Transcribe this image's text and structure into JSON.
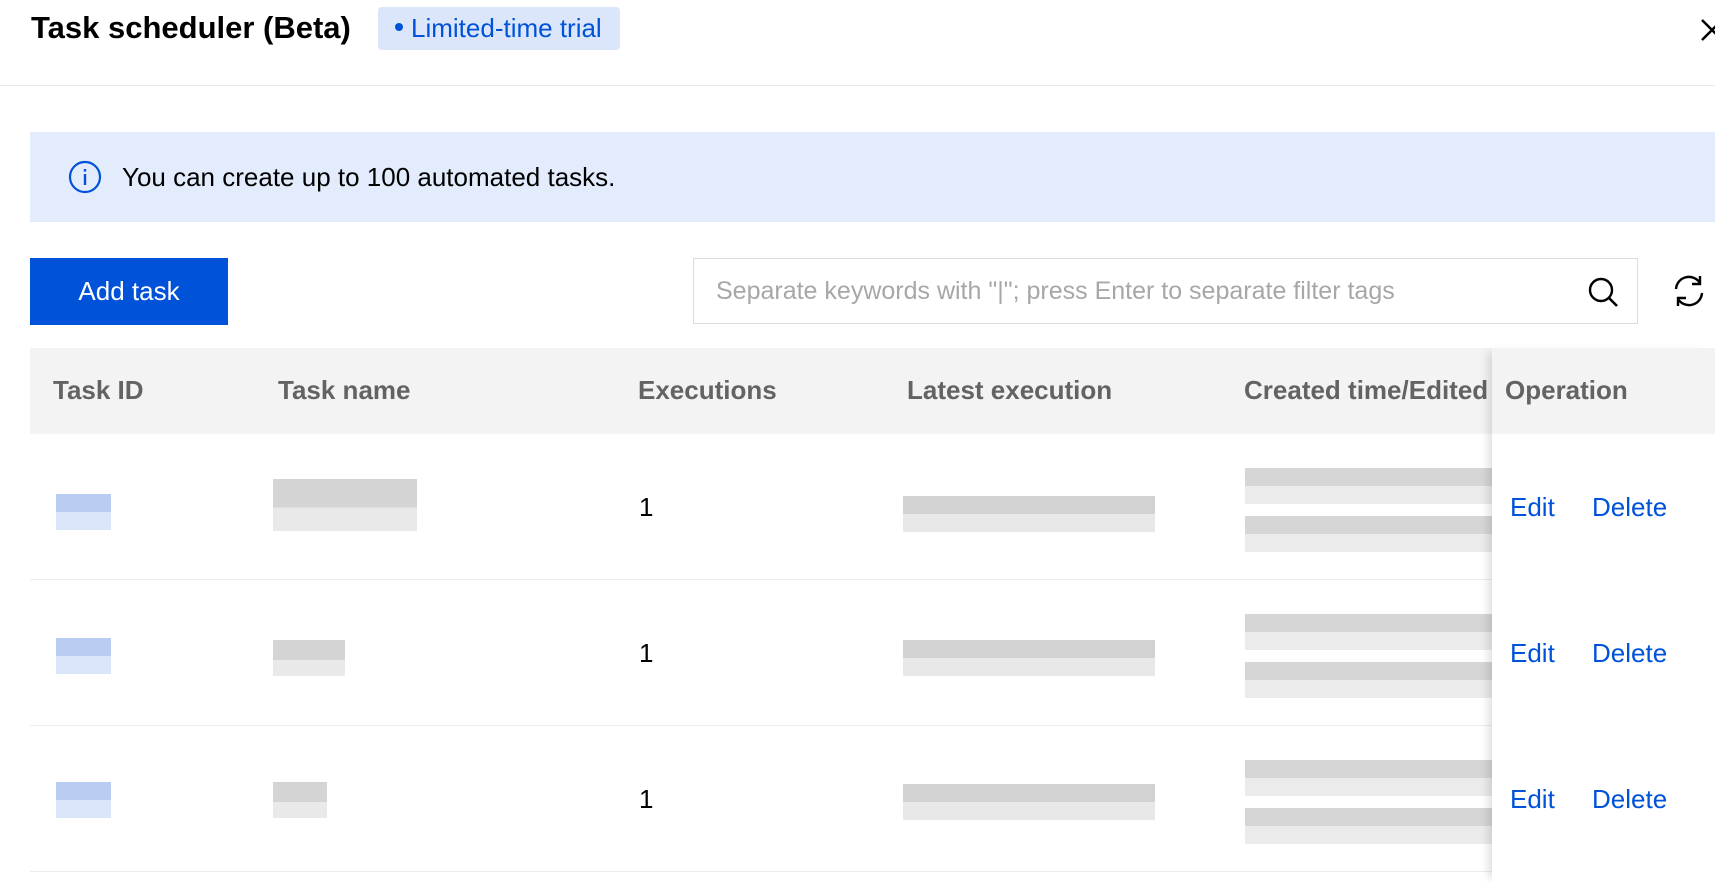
{
  "header": {
    "title": "Task scheduler (Beta)",
    "badge": "Limited-time trial"
  },
  "info": {
    "text": "You can create up to 100 automated tasks."
  },
  "toolbar": {
    "add_label": "Add task",
    "search_placeholder": "Separate keywords with \"|\"; press Enter to separate filter tags"
  },
  "table": {
    "columns": [
      "Task ID",
      "Task name",
      "Executions",
      "Latest execution",
      "Created time/Edited",
      "Operation"
    ],
    "rows": [
      {
        "executions": "1",
        "edit": "Edit",
        "delete": "Delete"
      },
      {
        "executions": "1",
        "edit": "Edit",
        "delete": "Delete"
      },
      {
        "executions": "1",
        "edit": "Edit",
        "delete": "Delete"
      }
    ]
  },
  "colors": {
    "primary": "#0052d9",
    "info_bg": "#e3ecfd",
    "badge_bg": "#dbe6fb"
  }
}
